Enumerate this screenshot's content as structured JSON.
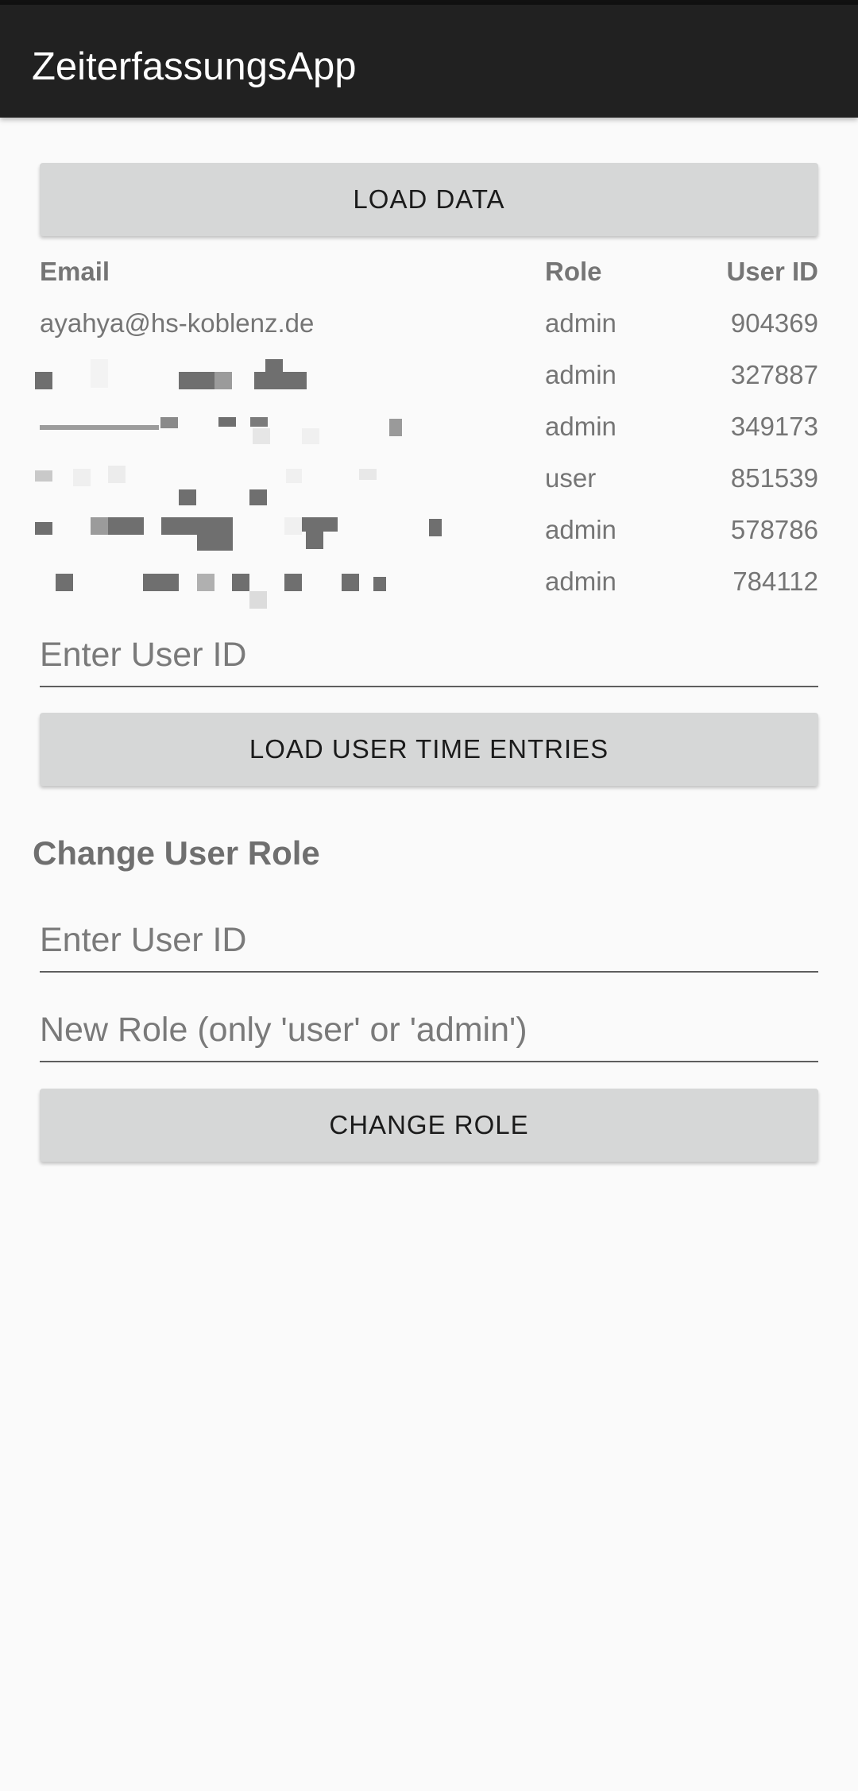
{
  "app_bar": {
    "title": "ZeiterfassungsApp"
  },
  "buttons": {
    "load_data": "LOAD DATA",
    "load_user_time_entries": "LOAD USER TIME ENTRIES",
    "change_role": "CHANGE ROLE"
  },
  "users_table": {
    "columns": [
      "Email",
      "Role",
      "User ID"
    ],
    "rows": [
      {
        "email": "ayahya@hs-koblenz.de",
        "role": "admin",
        "user_id": "904369"
      },
      {
        "email": "",
        "role": "admin",
        "user_id": "327887"
      },
      {
        "email": "",
        "role": "admin",
        "user_id": "349173"
      },
      {
        "email": "",
        "role": "user",
        "user_id": "851539"
      },
      {
        "email": "",
        "role": "admin",
        "user_id": "578786"
      },
      {
        "email": "",
        "role": "admin",
        "user_id": "784112"
      }
    ]
  },
  "load_entries": {
    "user_id_placeholder": "Enter User ID"
  },
  "change_role": {
    "title": "Change User Role",
    "user_id_placeholder": "Enter User ID",
    "role_placeholder": "New Role (only 'user' or 'admin')"
  },
  "colors": {
    "app_bar": "#212121",
    "background": "#fafafa",
    "button": "#d6d7d7",
    "redaction": "#6f6f6f"
  }
}
